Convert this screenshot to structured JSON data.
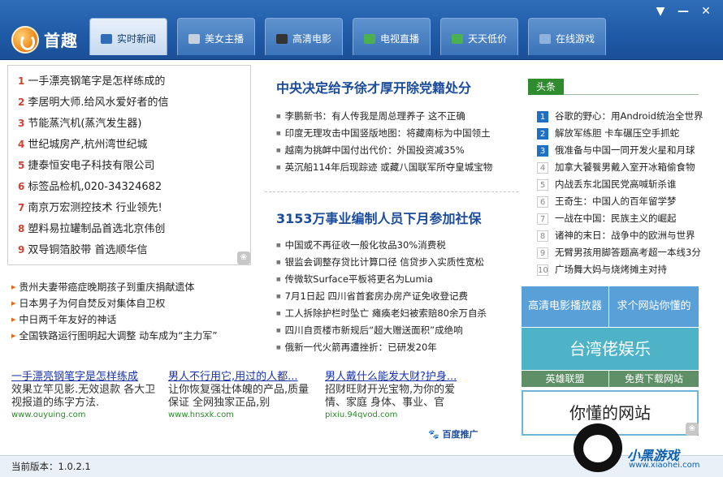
{
  "app": {
    "brand": "首趣",
    "version_label": "当前版本：1.0.2.1"
  },
  "window": {
    "minimize": "▼",
    "restore": "—",
    "close": "✕"
  },
  "tabs": [
    {
      "label": "实时新闻",
      "icon": "news-icon",
      "color": "#2f6db8"
    },
    {
      "label": "美女主播",
      "icon": "person-icon",
      "color": "#6f7ea0"
    },
    {
      "label": "高清电影",
      "icon": "film-icon",
      "color": "#444"
    },
    {
      "label": "电视直播",
      "icon": "people-icon",
      "color": "#3a9a3a"
    },
    {
      "label": "天天低价",
      "icon": "tag-icon",
      "color": "#3aa04a"
    },
    {
      "label": "在线游戏",
      "icon": "gamepad-icon",
      "color": "#5a7aa8"
    }
  ],
  "left_ads": [
    {
      "num": "1",
      "text": "一手漂亮钢笔字是怎样练成的"
    },
    {
      "num": "2",
      "text": "李居明大师.给风水爱好者的信"
    },
    {
      "num": "3",
      "text": "节能蒸汽机(蒸汽发生器)"
    },
    {
      "num": "4",
      "text": "世纪城房产,杭州湾世纪城"
    },
    {
      "num": "5",
      "text": "捷泰恒安电子科技有限公司"
    },
    {
      "num": "6",
      "text": "标签品检机,020-34324682"
    },
    {
      "num": "7",
      "text": "南京万宏测控技术  行业领先!"
    },
    {
      "num": "8",
      "text": "塑料易拉罐制品首选北京伟创"
    },
    {
      "num": "9",
      "text": "双导铜箔胶带  首选顺华信"
    }
  ],
  "left_news": [
    "贵州夫妻带癌症晚期孩子到重庆捐献遗体",
    "日本男子为何自焚反对集体自卫权",
    "中日两千年友好的神话",
    "全国铁路运行图明起大调整  动车成为“主力军”"
  ],
  "middle": {
    "headline1": "中央决定给予徐才厚开除党籍处分",
    "list1": [
      "李鹏新书：有人传我是周总理养子  这不正确",
      "印度无理攻击中国竖版地图：将藏南标为中国领土",
      "越南为挑衅中国付出代价：外国投资减35%",
      "英沉船114年后现踪迹  或藏八国联军所夺皇城宝物"
    ],
    "headline2": "3153万事业编制人员下月参加社保",
    "list2": [
      "中国或不再征收一般化妆品30%消费税",
      "银监会调整存贷比计算口径  信贷步入实质性宽松",
      "传微软Surface平板将更名为Lumia",
      "7月1日起  四川省首套房办房产证免收登记费",
      "工人拆除护栏时坠亡  瘫痪老妇被索赔80余万自杀",
      "四川自贡楼市新规后“超大赠送面积”成绝响",
      "俄新一代火箭再遭挫折：已研发20年"
    ]
  },
  "headlines": {
    "tab_label": "头条",
    "items": [
      {
        "num": "1",
        "text": "谷歌的野心：用Android统治全世界"
      },
      {
        "num": "2",
        "text": "解放军练胆  卡车碾压空手抓蛇"
      },
      {
        "num": "3",
        "text": "俄准备与中国一同开发火星和月球"
      },
      {
        "num": "4",
        "text": "加拿大饕餮男戴入室开冰箱偷食物"
      },
      {
        "num": "5",
        "text": "内战丢东北国民党高喊斩杀谁"
      },
      {
        "num": "6",
        "text": "王奇生：中国人的百年留学梦"
      },
      {
        "num": "7",
        "text": "一战在中国：民族主义的崛起"
      },
      {
        "num": "8",
        "text": "诸神的末日：战争中的欧洲与世界"
      },
      {
        "num": "9",
        "text": "无臂男孩用脚答题高考超一本线3分"
      },
      {
        "num": "10",
        "text": "广场舞大妈与烧烤摊主对持"
      }
    ]
  },
  "right_ads": {
    "a1": "高清电影播放器",
    "a2": "求个网站你懂的",
    "a3": "台湾佬娱乐",
    "a4": "英雄联盟",
    "a5": "免费下载网站",
    "a6": "你懂的网站"
  },
  "bottom_ads": [
    {
      "title": "一手漂亮钢笔字是怎样练成",
      "desc": "效果立竿见影.无效退款  各大卫视报道的练字方法.",
      "url": "www.ouyuing.com"
    },
    {
      "title": "男人不行用它,用过的人都...",
      "desc": "让你恢复强壮体魄的产品,质量保证  全网独家正品,别",
      "url": "www.hnsxk.com"
    },
    {
      "title": "男人戴什么能发大财?护身...",
      "desc": "招财旺财开光宝物,为你的爱情、家庭  身体、事业、官",
      "url": "pixiu.94qvod.com"
    }
  ],
  "baidu_label": "百度推广",
  "watermark": {
    "text": "小黑游戏",
    "url": "www.xiaohei.com"
  }
}
